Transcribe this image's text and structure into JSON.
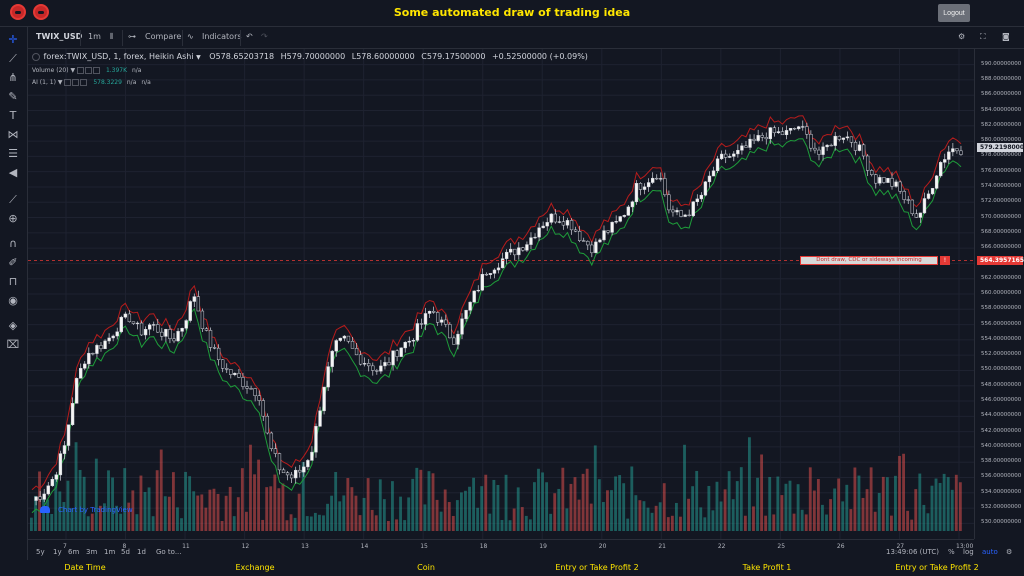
{
  "header": {
    "title": "Some automated draw of trading idea",
    "logout_label": "Logout",
    "logo_icons": [
      "red-eye-logo-icon",
      "red-eye-logo-icon"
    ]
  },
  "toolbar": {
    "symbol": "TWIX_USD",
    "interval": "1m",
    "compare_label": "Compare",
    "indicators_label": "Indicators",
    "icons": [
      "candles-icon",
      "compare-icon",
      "indicators-icon",
      "undo-icon",
      "redo-icon",
      "settings-icon",
      "fullscreen-icon",
      "camera-icon"
    ]
  },
  "left_tools": [
    "crosshair-icon",
    "trend-line-icon",
    "pitchfork-icon",
    "brush-icon",
    "text-icon",
    "pattern-icon",
    "gann-icon",
    "back-arrow-icon",
    "ruler-icon",
    "zoom-icon",
    "magnet-icon",
    "lock-drawing-icon",
    "lock-icon",
    "eye-icon",
    "layers-icon",
    "trash-icon"
  ],
  "legend": {
    "title": "forex:TWIX_USD, 1, forex, Heikin Ashi",
    "open": "O578.65203718",
    "high": "H579.70000000",
    "low": "L578.60000000",
    "close": "C579.17500000",
    "change": "+0.52500000 (+0.09%)",
    "volume_label": "Volume (20)",
    "volume_value": "1.397K",
    "volume_na": "n/a",
    "ai_label": "AI (1, 1)",
    "ai_value": "578.3229",
    "ai_na1": "n/a",
    "ai_na2": "n/a"
  },
  "price_axis": {
    "ticks": [
      "590.00000000",
      "588.00000000",
      "586.00000000",
      "584.00000000",
      "582.00000000",
      "580.00000000",
      "578.00000000",
      "576.00000000",
      "574.00000000",
      "572.00000000",
      "570.00000000",
      "568.00000000",
      "566.00000000",
      "564.00000000",
      "562.00000000",
      "560.00000000",
      "558.00000000",
      "556.00000000",
      "554.00000000",
      "552.00000000",
      "550.00000000",
      "548.00000000",
      "546.00000000",
      "544.00000000",
      "542.00000000",
      "540.00000000",
      "538.00000000",
      "536.00000000",
      "534.00000000",
      "532.00000000",
      "530.00000000"
    ],
    "current_price": "579.21980000",
    "line_price": "564.39571652"
  },
  "alert": {
    "text": "Dont draw, CDC or sideways incoming",
    "button": "!"
  },
  "time_axis": {
    "ticks": [
      "7",
      "8",
      "11",
      "12",
      "13",
      "14",
      "15",
      "18",
      "19",
      "20",
      "21",
      "22",
      "25",
      "26",
      "27",
      "13:00"
    ]
  },
  "range_bar": {
    "items": [
      "5y",
      "1y",
      "6m",
      "3m",
      "1m",
      "5d",
      "1d"
    ],
    "goto_label": "Go to...",
    "clock": "13:49:06 (UTC)",
    "percent": "%",
    "log": "log",
    "auto": "auto",
    "gear_icon": "settings-icon"
  },
  "brand": {
    "text": "Chart by TradingView",
    "icon": "cloud-icon"
  },
  "footer": {
    "columns": [
      "Date Time",
      "Exchange",
      "Coin",
      "Entry or Take Profit 2",
      "Take Profit 1",
      "Entry or Take Profit 2"
    ]
  },
  "colors": {
    "background": "#131722",
    "up": "#26a69a",
    "down": "#ef5350",
    "accent_yellow": "#ffe600",
    "alert_red": "#e53935"
  },
  "chart_data": {
    "type": "candlestick",
    "y_range": [
      529,
      591
    ],
    "price_series": [
      533,
      534,
      536,
      540,
      548,
      552,
      553,
      554,
      556,
      557,
      555,
      556,
      555,
      554,
      556,
      560,
      555,
      552,
      550,
      549,
      548,
      547,
      540,
      537,
      536,
      537,
      540,
      548,
      553,
      554,
      552,
      551,
      550,
      551,
      553,
      554,
      556,
      558,
      556,
      554,
      557,
      560,
      563,
      564,
      565,
      566,
      567,
      569,
      570,
      570,
      569,
      567,
      566,
      568,
      569,
      571,
      574,
      575,
      576,
      571,
      570,
      571,
      573,
      576,
      578,
      578,
      579,
      580,
      581,
      581,
      581,
      582,
      580,
      578,
      580,
      581,
      580,
      578,
      575,
      575,
      574,
      572,
      570,
      573,
      577,
      579,
      579
    ],
    "resistance_line": 564.4
  }
}
